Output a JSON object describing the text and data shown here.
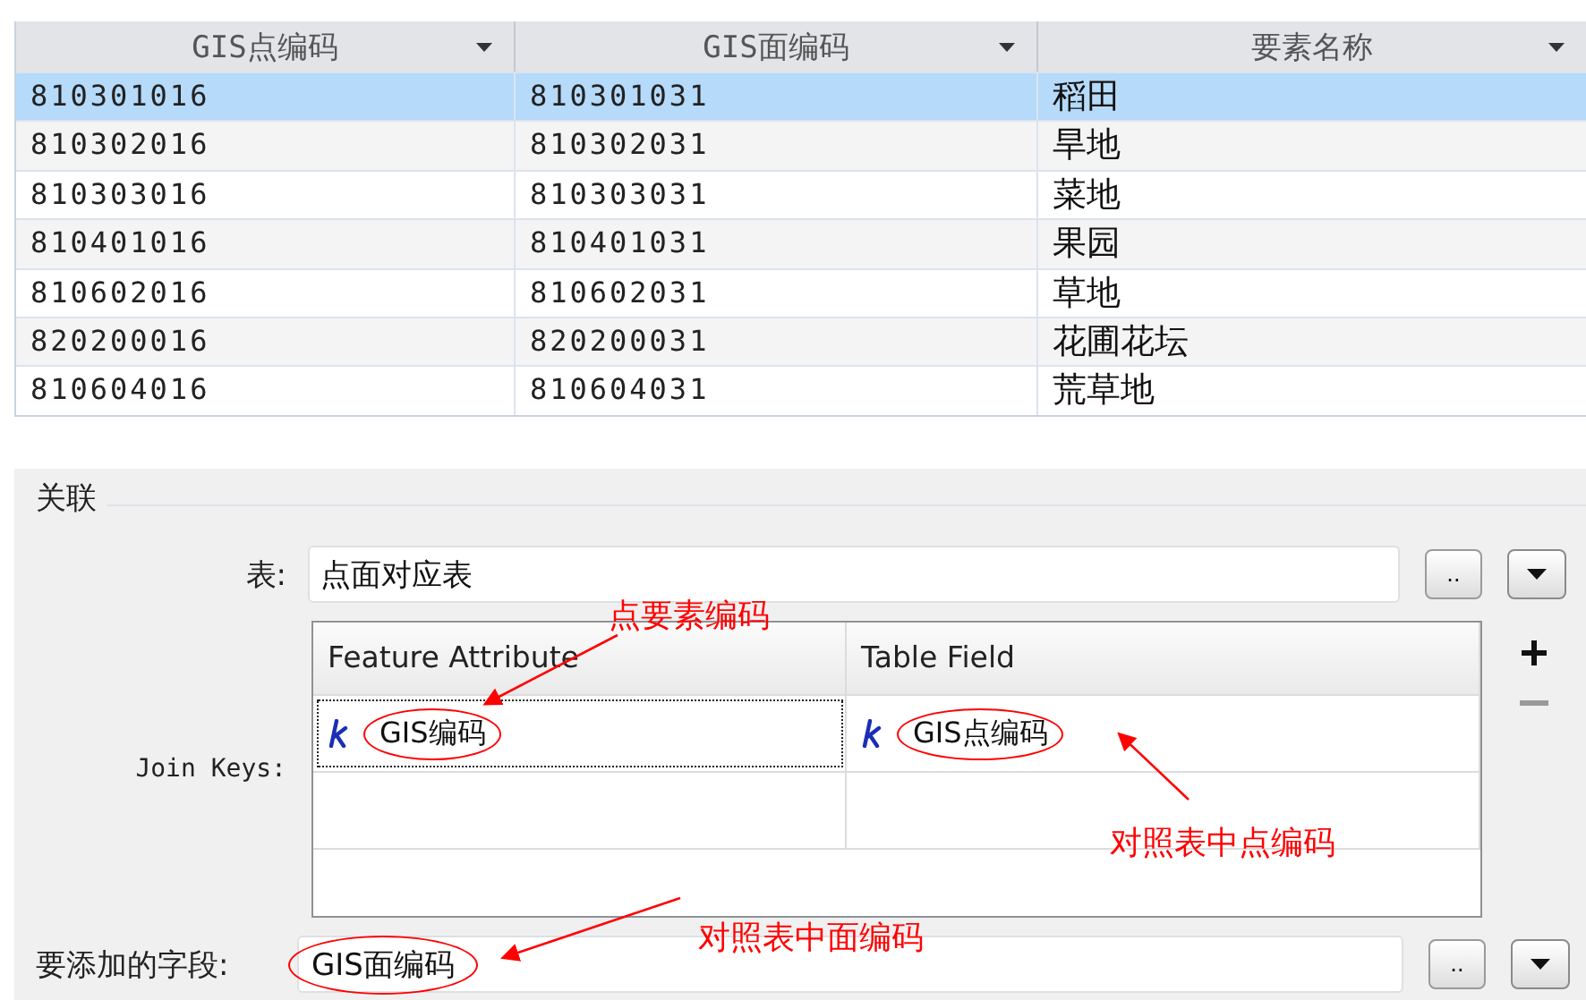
{
  "table": {
    "columns": [
      {
        "label": "GIS点编码"
      },
      {
        "label": "GIS面编码"
      },
      {
        "label": "要素名称"
      }
    ],
    "rows": [
      {
        "cells": [
          "810301016",
          "810301031",
          "稻田"
        ],
        "selected": true
      },
      {
        "cells": [
          "810302016",
          "810302031",
          "旱地"
        ],
        "selected": false
      },
      {
        "cells": [
          "810303016",
          "810303031",
          "菜地"
        ],
        "selected": false
      },
      {
        "cells": [
          "810401016",
          "810401031",
          "果园"
        ],
        "selected": false
      },
      {
        "cells": [
          "810602016",
          "810602031",
          "草地"
        ],
        "selected": false
      },
      {
        "cells": [
          "820200016",
          "820200031",
          "花圃花坛"
        ],
        "selected": false
      },
      {
        "cells": [
          "810604016",
          "810604031",
          "荒草地"
        ],
        "selected": false
      }
    ]
  },
  "join_group": {
    "title": "关联",
    "table_label": "表:",
    "table_value": "点面对应表",
    "browse_label": "..",
    "join_keys_label": "Join Keys:",
    "keys_columns": [
      "Feature Attribute",
      "Table Field"
    ],
    "keys_rows": [
      {
        "cells": [
          "GIS编码",
          "GIS点编码"
        ],
        "focused": true
      }
    ],
    "field_label": "要添加的字段:",
    "field_value": "GIS面编码",
    "field_browse_label": ".."
  },
  "annotations": [
    {
      "text": "点要素编码"
    },
    {
      "text": "对照表中点编码"
    },
    {
      "text": "对照表中面编码"
    }
  ]
}
